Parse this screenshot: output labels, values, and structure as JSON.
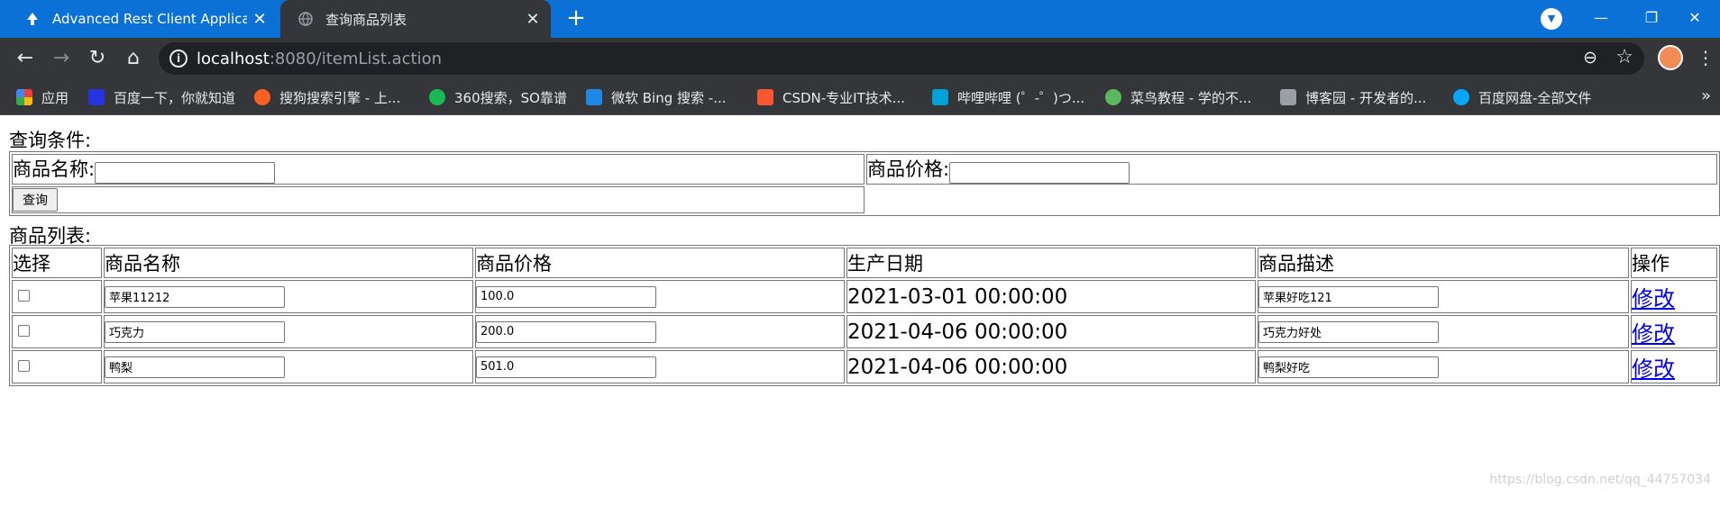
{
  "browser": {
    "tabs": [
      {
        "title": "Advanced Rest Client Applicati",
        "icon": "arc-icon"
      },
      {
        "title": "查询商品列表",
        "icon": "globe-icon"
      }
    ],
    "url_host": "localhost",
    "url_rest": ":8080/itemList.action",
    "bookmarks": [
      {
        "label": "应用",
        "color": "#e94235"
      },
      {
        "label": "百度一下，你就知道",
        "color": "#2932e1"
      },
      {
        "label": "搜狗搜索引擎 - 上...",
        "color": "#fb6022"
      },
      {
        "label": "360搜索，SO靠谱",
        "color": "#19b955"
      },
      {
        "label": "微软 Bing 搜索 -...",
        "color": "#1e88e5"
      },
      {
        "label": "CSDN-专业IT技术...",
        "color": "#fc5531"
      },
      {
        "label": "哔哩哔哩 (゜-゜)つ...",
        "color": "#00a1d6"
      },
      {
        "label": "菜鸟教程 - 学的不...",
        "color": "#5cb85c"
      },
      {
        "label": "博客园 - 开发者的...",
        "color": "#9aa0a6"
      },
      {
        "label": "百度网盘-全部文件",
        "color": "#06a7ff"
      }
    ]
  },
  "query": {
    "caption": "查询条件:",
    "name_label": "商品名称:",
    "price_label": "商品价格:",
    "name_value": "",
    "price_value": "",
    "button": "查询"
  },
  "list": {
    "caption": "商品列表:",
    "headers": [
      "选择",
      "商品名称",
      "商品价格",
      "生产日期",
      "商品描述",
      "操作"
    ],
    "rows": [
      {
        "name": "苹果11212",
        "price": "100.0",
        "date": "2021-03-01 00:00:00",
        "desc": "苹果好吃121",
        "action": "修改"
      },
      {
        "name": "巧克力",
        "price": "200.0",
        "date": "2021-04-06 00:00:00",
        "desc": "巧克力好处",
        "action": "修改"
      },
      {
        "name": "鸭梨",
        "price": "501.0",
        "date": "2021-04-06 00:00:00",
        "desc": "鸭梨好吃",
        "action": "修改"
      }
    ]
  },
  "watermark": "https://blog.csdn.net/qq_44757034"
}
